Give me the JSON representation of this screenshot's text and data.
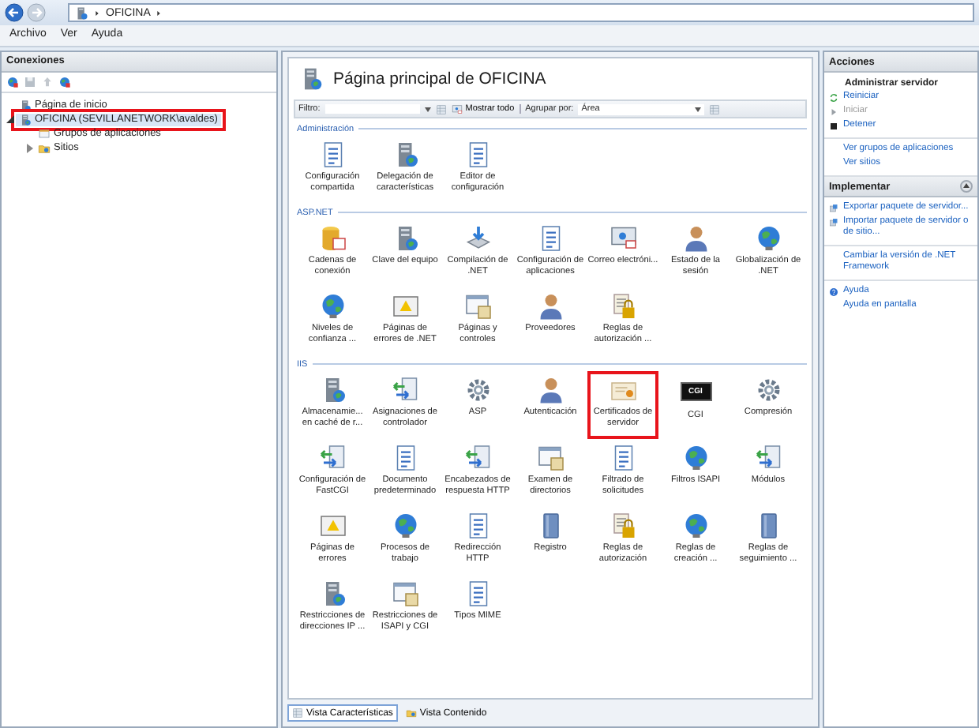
{
  "address_bar": {
    "path": [
      "OFICINA"
    ]
  },
  "menu": [
    "Archivo",
    "Ver",
    "Ayuda"
  ],
  "connections": {
    "title": "Conexiones",
    "tree": [
      {
        "label": "Página de inicio",
        "selected": false,
        "highlighted": false
      },
      {
        "label": "OFICINA (SEVILLANETWORK\\avaldes)",
        "selected": true,
        "highlighted": true,
        "expanded": true,
        "children": [
          {
            "label": "Grupos de aplicaciones",
            "selected": false,
            "highlighted": false
          },
          {
            "label": "Sitios",
            "selected": false,
            "highlighted": false,
            "expanded": false
          }
        ]
      }
    ]
  },
  "features": {
    "title": "Página principal de OFICINA",
    "filter_label": "Filtro:",
    "show_all": "Mostrar todo",
    "group_by_label": "Agrupar por:",
    "group_by": "Área",
    "groups": [
      {
        "name": "Administración",
        "items": [
          {
            "label": "Configuración compartida",
            "highlighted": false
          },
          {
            "label": "Delegación de características",
            "highlighted": false
          },
          {
            "label": "Editor de configuración",
            "highlighted": false
          }
        ]
      },
      {
        "name": "ASP.NET",
        "items": [
          {
            "label": "Cadenas de conexión",
            "highlighted": false
          },
          {
            "label": "Clave del equipo",
            "highlighted": false
          },
          {
            "label": "Compilación de .NET",
            "highlighted": false
          },
          {
            "label": "Configuración de aplicaciones",
            "highlighted": false
          },
          {
            "label": "Correo electróni...",
            "highlighted": false
          },
          {
            "label": "Estado de la sesión",
            "highlighted": false
          },
          {
            "label": "Globalización de .NET",
            "highlighted": false
          },
          {
            "label": "Niveles de confianza ...",
            "highlighted": false
          },
          {
            "label": "Páginas de errores de .NET",
            "highlighted": false
          },
          {
            "label": "Páginas y controles",
            "highlighted": false
          },
          {
            "label": "Proveedores",
            "highlighted": false
          },
          {
            "label": "Reglas de autorización ...",
            "highlighted": false
          }
        ]
      },
      {
        "name": "IIS",
        "items": [
          {
            "label": "Almacenamie... en caché de r...",
            "highlighted": false
          },
          {
            "label": "Asignaciones de controlador",
            "highlighted": false
          },
          {
            "label": "ASP",
            "highlighted": false
          },
          {
            "label": "Autenticación",
            "highlighted": false
          },
          {
            "label": "Certificados de servidor",
            "highlighted": true
          },
          {
            "label": "CGI",
            "icon_text": "CGI",
            "highlighted": false
          },
          {
            "label": "Compresión",
            "highlighted": false
          },
          {
            "label": "Configuración de FastCGI",
            "highlighted": false
          },
          {
            "label": "Documento predeterminado",
            "highlighted": false
          },
          {
            "label": "Encabezados de respuesta HTTP",
            "highlighted": false
          },
          {
            "label": "Examen de directorios",
            "highlighted": false
          },
          {
            "label": "Filtrado de solicitudes",
            "highlighted": false
          },
          {
            "label": "Filtros ISAPI",
            "highlighted": false
          },
          {
            "label": "Módulos",
            "highlighted": false
          },
          {
            "label": "Páginas de errores",
            "highlighted": false
          },
          {
            "label": "Procesos de trabajo",
            "highlighted": false
          },
          {
            "label": "Redirección HTTP",
            "highlighted": false
          },
          {
            "label": "Registro",
            "highlighted": false
          },
          {
            "label": "Reglas de autorización",
            "highlighted": false
          },
          {
            "label": "Reglas de creación ...",
            "highlighted": false
          },
          {
            "label": "Reglas de seguimiento ...",
            "highlighted": false
          },
          {
            "label": "Restricciones de direcciones IP ...",
            "highlighted": false
          },
          {
            "label": "Restricciones de ISAPI y CGI",
            "highlighted": false
          },
          {
            "label": "Tipos MIME",
            "highlighted": false
          }
        ]
      }
    ]
  },
  "view_tabs": [
    {
      "label": "Vista Características",
      "selected": true
    },
    {
      "label": "Vista Contenido",
      "selected": false
    }
  ],
  "actions": {
    "sections": [
      {
        "title": "Acciones",
        "groups": [
          {
            "items": [
              {
                "kind": "heading",
                "label": "Administrar servidor"
              },
              {
                "kind": "link",
                "label": "Reiniciar",
                "disabled": false
              },
              {
                "kind": "link",
                "label": "Iniciar",
                "disabled": true
              },
              {
                "kind": "link",
                "label": "Detener",
                "disabled": false
              }
            ]
          },
          {
            "items": [
              {
                "kind": "link",
                "label": "Ver grupos de aplicaciones",
                "disabled": false
              },
              {
                "kind": "link",
                "label": "Ver sitios",
                "disabled": false
              }
            ]
          }
        ]
      },
      {
        "title": "Implementar",
        "expanded": true,
        "groups": [
          {
            "items": [
              {
                "kind": "link",
                "label": "Exportar paquete de servidor...",
                "disabled": false
              },
              {
                "kind": "link",
                "label": "Importar paquete de servidor o de sitio...",
                "disabled": false
              }
            ]
          },
          {
            "items": [
              {
                "kind": "link",
                "label": "Cambiar la versión de .NET Framework",
                "disabled": false
              }
            ]
          },
          {
            "items": [
              {
                "kind": "link",
                "label": "Ayuda",
                "disabled": false
              },
              {
                "kind": "link",
                "label": "Ayuda en pantalla",
                "disabled": false
              }
            ]
          }
        ]
      }
    ]
  }
}
